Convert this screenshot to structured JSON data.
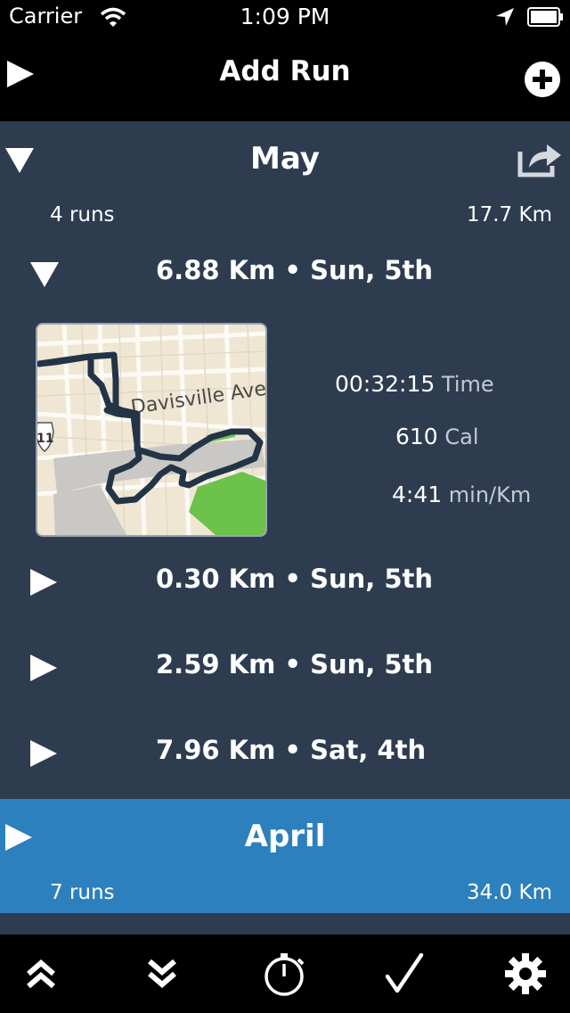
{
  "status": {
    "carrier": "Carrier",
    "time": "1:09 PM",
    "icons": [
      "wifi-icon",
      "location-arrow-icon",
      "battery-icon"
    ]
  },
  "navbar": {
    "title": "Add Run",
    "left_icon": "play-icon",
    "right_icon": "add-circle-icon"
  },
  "months": [
    {
      "name": "May",
      "runs_label": "4 runs",
      "distance": "17.7 Km",
      "expanded": true,
      "runs": [
        {
          "title": "6.88 Km • Sun, 5th",
          "expanded": true,
          "map_label": "Davisville Ave",
          "map_shield": "11",
          "stats": {
            "time": {
              "value": "00:32:15",
              "unit": "Time"
            },
            "cal": {
              "value": "610",
              "unit": "Cal"
            },
            "pace": {
              "value": "4:41",
              "unit": "min/Km"
            }
          }
        },
        {
          "title": "0.30 Km • Sun, 5th",
          "expanded": false
        },
        {
          "title": "2.59 Km • Sun, 5th",
          "expanded": false
        },
        {
          "title": "7.96 Km • Sat, 4th",
          "expanded": false
        }
      ]
    },
    {
      "name": "April",
      "runs_label": "7 runs",
      "distance": "34.0 Km",
      "expanded": false
    }
  ],
  "toolbar": [
    "collapse-all-icon",
    "expand-all-icon",
    "stopwatch-icon",
    "checkmark-icon",
    "gear-icon"
  ],
  "colors": {
    "section_bg": "#2e3c50",
    "highlight_bg": "#2c80bd",
    "bar_bg": "#000000",
    "route": "#243447",
    "park": "#6cc24a"
  }
}
